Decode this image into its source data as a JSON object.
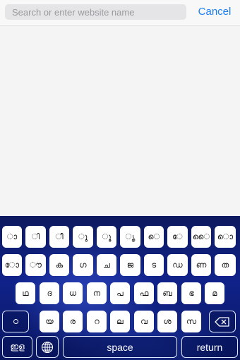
{
  "search": {
    "placeholder": "Search or enter website name",
    "value": ""
  },
  "cancel_label": "Cancel",
  "keyboard": {
    "row1": [
      "ാ",
      "ി",
      "ീ",
      "ു",
      "ൂ",
      "ൃ",
      "െ",
      "േ",
      "ൈ",
      "ൊ"
    ],
    "row2": [
      "ോ",
      "ൗ",
      "ക",
      "ഗ",
      "ച",
      "ജ",
      "ട",
      "ഡ",
      "ണ",
      "ത"
    ],
    "row3": [
      "ഥ",
      "ദ",
      "ധ",
      "ന",
      "പ",
      "ഫ",
      "ബ",
      "ഭ",
      "മ"
    ],
    "row4": [
      "യ",
      "ര",
      "റ",
      "ല",
      "വ",
      "ശ",
      "സ"
    ],
    "shift_label": "ഠ",
    "mode_label": "ഇള",
    "space_label": "space",
    "return_label": "return"
  }
}
